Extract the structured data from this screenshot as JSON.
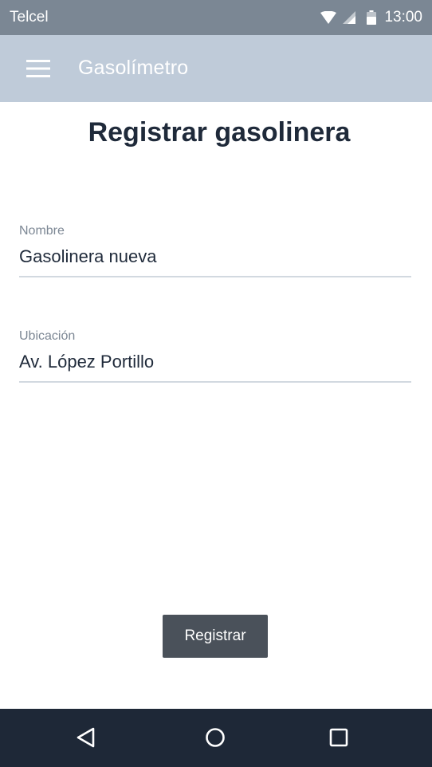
{
  "status_bar": {
    "carrier": "Telcel",
    "time": "13:00",
    "icons": [
      "wifi-icon",
      "signal-icon",
      "battery-icon"
    ]
  },
  "app_bar": {
    "title": "Gasolímetro",
    "menu_icon": "hamburger-menu-icon"
  },
  "page": {
    "title": "Registrar gasolinera"
  },
  "form": {
    "name": {
      "label": "Nombre",
      "value": "Gasolinera nueva"
    },
    "location": {
      "label": "Ubicación",
      "value": "Av. López Portillo"
    },
    "submit_label": "Registrar"
  },
  "nav_bar": {
    "icons": [
      "back-icon",
      "home-icon",
      "recent-apps-icon"
    ]
  },
  "colors": {
    "status_bar": "#7b8794",
    "app_bar": "#bfcbd9",
    "title_text": "#1f2a3a",
    "button": "#4a515a",
    "nav_bar": "#1e2837"
  }
}
